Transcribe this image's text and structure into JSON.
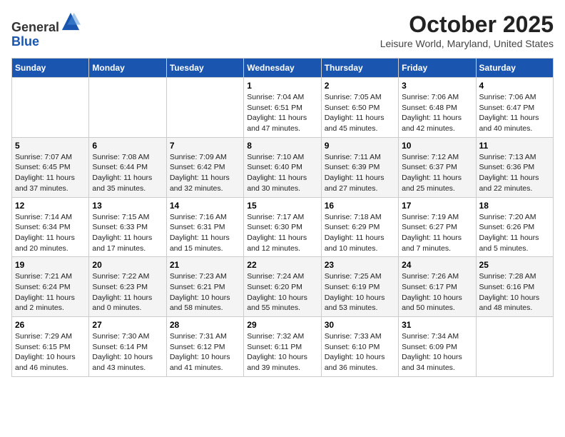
{
  "header": {
    "logo_general": "General",
    "logo_blue": "Blue",
    "month_title": "October 2025",
    "location": "Leisure World, Maryland, United States"
  },
  "weekdays": [
    "Sunday",
    "Monday",
    "Tuesday",
    "Wednesday",
    "Thursday",
    "Friday",
    "Saturday"
  ],
  "weeks": [
    [
      {
        "day": "",
        "info": ""
      },
      {
        "day": "",
        "info": ""
      },
      {
        "day": "",
        "info": ""
      },
      {
        "day": "1",
        "info": "Sunrise: 7:04 AM\nSunset: 6:51 PM\nDaylight: 11 hours\nand 47 minutes."
      },
      {
        "day": "2",
        "info": "Sunrise: 7:05 AM\nSunset: 6:50 PM\nDaylight: 11 hours\nand 45 minutes."
      },
      {
        "day": "3",
        "info": "Sunrise: 7:06 AM\nSunset: 6:48 PM\nDaylight: 11 hours\nand 42 minutes."
      },
      {
        "day": "4",
        "info": "Sunrise: 7:06 AM\nSunset: 6:47 PM\nDaylight: 11 hours\nand 40 minutes."
      }
    ],
    [
      {
        "day": "5",
        "info": "Sunrise: 7:07 AM\nSunset: 6:45 PM\nDaylight: 11 hours\nand 37 minutes."
      },
      {
        "day": "6",
        "info": "Sunrise: 7:08 AM\nSunset: 6:44 PM\nDaylight: 11 hours\nand 35 minutes."
      },
      {
        "day": "7",
        "info": "Sunrise: 7:09 AM\nSunset: 6:42 PM\nDaylight: 11 hours\nand 32 minutes."
      },
      {
        "day": "8",
        "info": "Sunrise: 7:10 AM\nSunset: 6:40 PM\nDaylight: 11 hours\nand 30 minutes."
      },
      {
        "day": "9",
        "info": "Sunrise: 7:11 AM\nSunset: 6:39 PM\nDaylight: 11 hours\nand 27 minutes."
      },
      {
        "day": "10",
        "info": "Sunrise: 7:12 AM\nSunset: 6:37 PM\nDaylight: 11 hours\nand 25 minutes."
      },
      {
        "day": "11",
        "info": "Sunrise: 7:13 AM\nSunset: 6:36 PM\nDaylight: 11 hours\nand 22 minutes."
      }
    ],
    [
      {
        "day": "12",
        "info": "Sunrise: 7:14 AM\nSunset: 6:34 PM\nDaylight: 11 hours\nand 20 minutes."
      },
      {
        "day": "13",
        "info": "Sunrise: 7:15 AM\nSunset: 6:33 PM\nDaylight: 11 hours\nand 17 minutes."
      },
      {
        "day": "14",
        "info": "Sunrise: 7:16 AM\nSunset: 6:31 PM\nDaylight: 11 hours\nand 15 minutes."
      },
      {
        "day": "15",
        "info": "Sunrise: 7:17 AM\nSunset: 6:30 PM\nDaylight: 11 hours\nand 12 minutes."
      },
      {
        "day": "16",
        "info": "Sunrise: 7:18 AM\nSunset: 6:29 PM\nDaylight: 11 hours\nand 10 minutes."
      },
      {
        "day": "17",
        "info": "Sunrise: 7:19 AM\nSunset: 6:27 PM\nDaylight: 11 hours\nand 7 minutes."
      },
      {
        "day": "18",
        "info": "Sunrise: 7:20 AM\nSunset: 6:26 PM\nDaylight: 11 hours\nand 5 minutes."
      }
    ],
    [
      {
        "day": "19",
        "info": "Sunrise: 7:21 AM\nSunset: 6:24 PM\nDaylight: 11 hours\nand 2 minutes."
      },
      {
        "day": "20",
        "info": "Sunrise: 7:22 AM\nSunset: 6:23 PM\nDaylight: 11 hours\nand 0 minutes."
      },
      {
        "day": "21",
        "info": "Sunrise: 7:23 AM\nSunset: 6:21 PM\nDaylight: 10 hours\nand 58 minutes."
      },
      {
        "day": "22",
        "info": "Sunrise: 7:24 AM\nSunset: 6:20 PM\nDaylight: 10 hours\nand 55 minutes."
      },
      {
        "day": "23",
        "info": "Sunrise: 7:25 AM\nSunset: 6:19 PM\nDaylight: 10 hours\nand 53 minutes."
      },
      {
        "day": "24",
        "info": "Sunrise: 7:26 AM\nSunset: 6:17 PM\nDaylight: 10 hours\nand 50 minutes."
      },
      {
        "day": "25",
        "info": "Sunrise: 7:28 AM\nSunset: 6:16 PM\nDaylight: 10 hours\nand 48 minutes."
      }
    ],
    [
      {
        "day": "26",
        "info": "Sunrise: 7:29 AM\nSunset: 6:15 PM\nDaylight: 10 hours\nand 46 minutes."
      },
      {
        "day": "27",
        "info": "Sunrise: 7:30 AM\nSunset: 6:14 PM\nDaylight: 10 hours\nand 43 minutes."
      },
      {
        "day": "28",
        "info": "Sunrise: 7:31 AM\nSunset: 6:12 PM\nDaylight: 10 hours\nand 41 minutes."
      },
      {
        "day": "29",
        "info": "Sunrise: 7:32 AM\nSunset: 6:11 PM\nDaylight: 10 hours\nand 39 minutes."
      },
      {
        "day": "30",
        "info": "Sunrise: 7:33 AM\nSunset: 6:10 PM\nDaylight: 10 hours\nand 36 minutes."
      },
      {
        "day": "31",
        "info": "Sunrise: 7:34 AM\nSunset: 6:09 PM\nDaylight: 10 hours\nand 34 minutes."
      },
      {
        "day": "",
        "info": ""
      }
    ]
  ]
}
